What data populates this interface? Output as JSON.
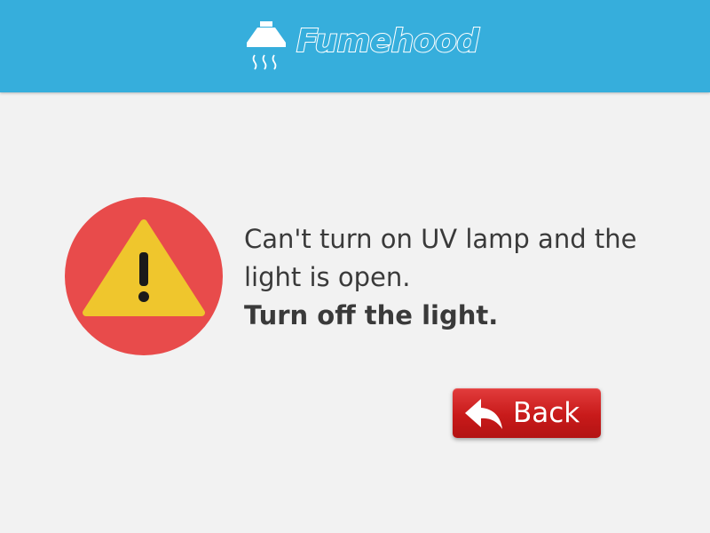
{
  "header": {
    "logo_text": "Fumehood",
    "background_color": "#36aedc"
  },
  "alert": {
    "icon": "warning-triangle-icon",
    "circle_color": "#e84b4b",
    "triangle_color": "#efc62d",
    "lines": [
      "Can't turn on UV lamp and the",
      "light is open."
    ],
    "emphasis": "Turn off the light."
  },
  "back_button": {
    "label": "Back",
    "icon": "back-arrow-icon",
    "color": "#c81a1a"
  }
}
